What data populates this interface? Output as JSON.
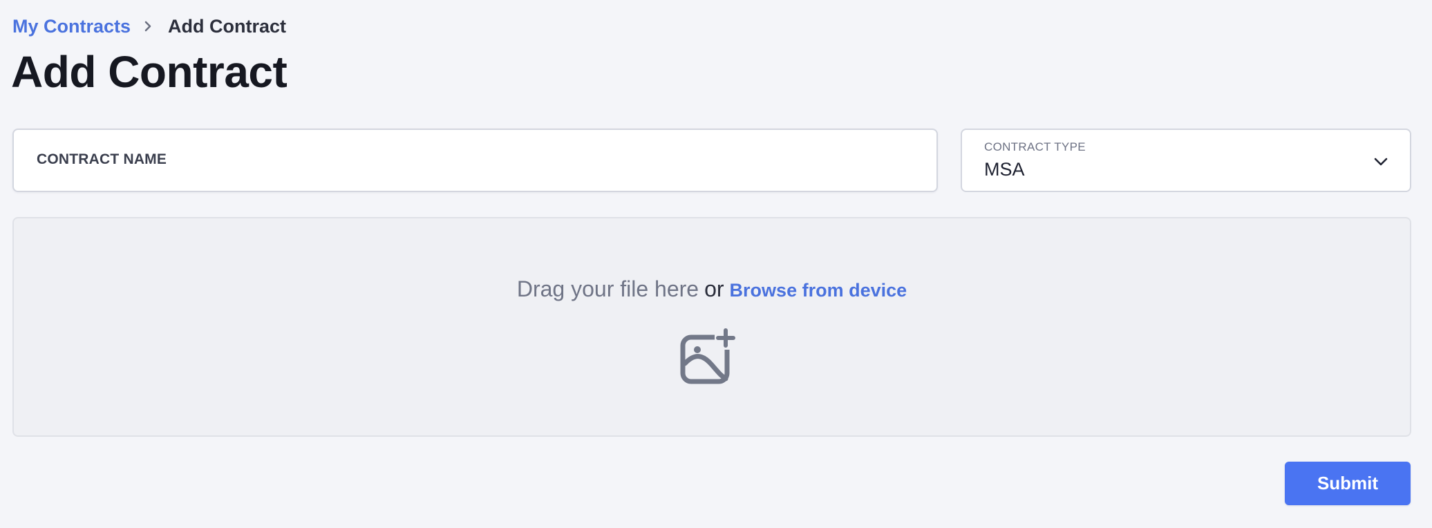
{
  "breadcrumb": {
    "parent_label": "My Contracts",
    "current_label": "Add Contract",
    "separator_icon": "chevron-right-icon"
  },
  "page": {
    "title": "Add Contract"
  },
  "form": {
    "contract_name": {
      "label": "CONTRACT NAME",
      "value": ""
    },
    "contract_type": {
      "label": "CONTRACT TYPE",
      "selected": "MSA",
      "icon": "chevron-down-icon"
    }
  },
  "upload": {
    "prompt": "Drag your file here",
    "or_text": "or",
    "browse_label": "Browse from device",
    "icon": "add-image-icon"
  },
  "actions": {
    "submit_label": "Submit"
  },
  "colors": {
    "accent": "#4a72de",
    "button": "#4a74f2",
    "background": "#f4f5f9",
    "dropzone": "#eff0f4"
  }
}
